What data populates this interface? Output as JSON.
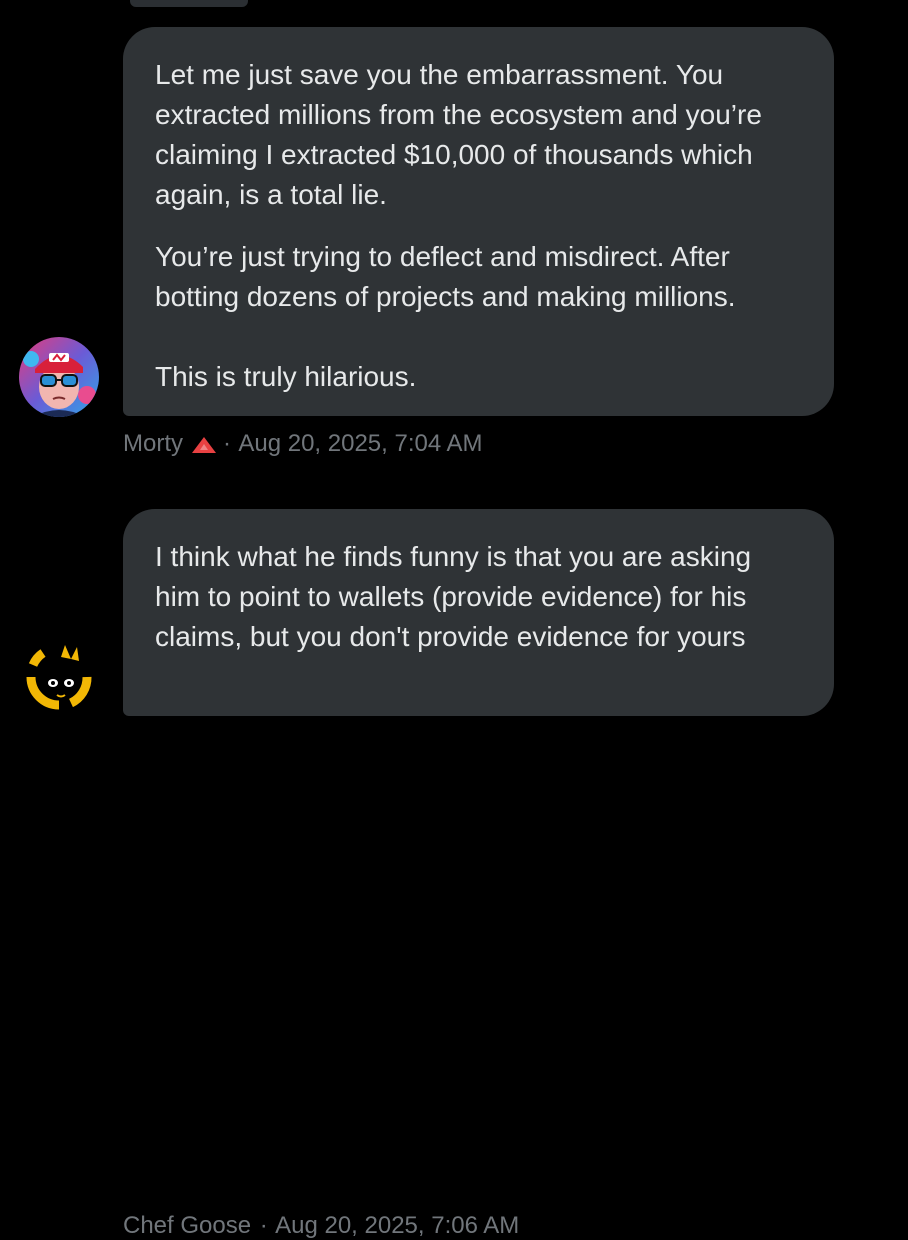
{
  "messages": [
    {
      "paragraphs": [
        "Let me just save you the embarrassment. You extracted millions from the ecosystem and you’re claiming I extracted $10,000 of thousands which again, is a total lie.",
        "You’re just trying to deflect and misdirect. After botting dozens of projects and making millions.\n\nThis is truly hilarious."
      ],
      "author": "Morty",
      "separator": "·",
      "timestamp": "Aug 20, 2025, 7:04 AM",
      "badge_icon": "red-triangle-icon",
      "badge_color": "#e84142"
    },
    {
      "paragraphs": [
        "I think what he finds funny is that you are asking him to point to wallets (provide evidence) for his claims, but you don't provide evidence for yours"
      ],
      "author": "Chef Goose",
      "separator": "·",
      "timestamp": "Aug 20, 2025, 7:06 AM"
    }
  ],
  "colors": {
    "background": "#000000",
    "bubble": "#2f3336",
    "text": "#e7e9ea",
    "meta": "#71767b",
    "goose_avatar_accent": "#f2b705"
  }
}
